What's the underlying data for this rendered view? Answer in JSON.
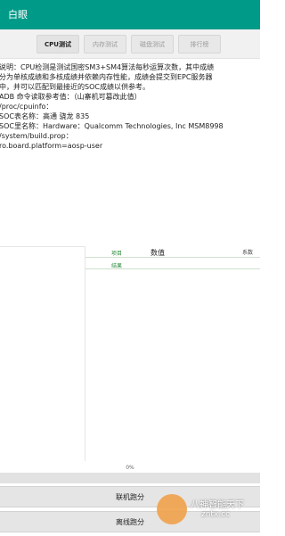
{
  "app": {
    "title": "白眼"
  },
  "tabs": [
    {
      "label": "CPU测试",
      "active": true
    },
    {
      "label": "内存测试",
      "active": false
    },
    {
      "label": "磁盘测试",
      "active": false
    },
    {
      "label": "排行榜",
      "active": false
    }
  ],
  "info_lines": [
    "说明：CPU检测是测试国密SM3+SM4算法每秒运算次数，其中成绩",
    "分为单核成绩和多核成绩并依赖内存性能，成绩会提交到EPC服务器",
    "中，并可以匹配到最接近的SOC成绩以供参考。",
    "ADB 命令读取参考值：（山寨机可篡改此值）",
    "/proc/cpuinfo：",
    "SOC表名称：高通 骁龙 835",
    "SOC里名称：Hardware：Qualcomm Technologies, Inc MSM8998",
    "/system/build.prop：",
    "ro.board.platform=aosp-user"
  ],
  "results": {
    "col_item": "项目",
    "col_value": "数值",
    "col_coef": "系数",
    "row_result": "结果"
  },
  "progress": {
    "label": "0%",
    "value": 0.0
  },
  "buttons": {
    "online": "联机跑分",
    "offline": "离线跑分"
  },
  "watermark": {
    "line1": "八神智能天下",
    "line2": "zntx.cc"
  },
  "colors": {
    "appbar": "#009a88",
    "item_text": "#2a8a3a"
  }
}
